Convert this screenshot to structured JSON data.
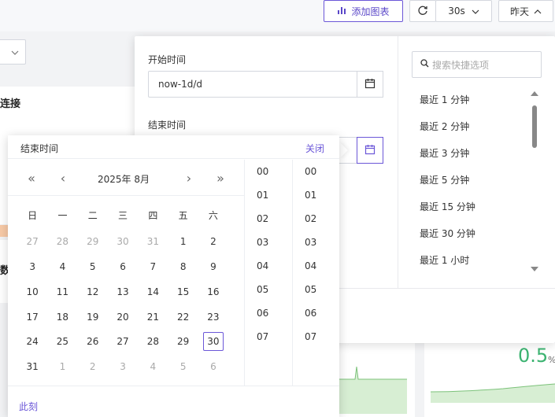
{
  "toolbar": {
    "add_chart_label": "添加图表",
    "refresh_interval": "30s",
    "time_range": "昨天"
  },
  "background": {
    "panel_title_1": "连接",
    "panel_title_2": "数",
    "metric_value": "0.5",
    "metric_unit": "%"
  },
  "range": {
    "start_label": "开始时间",
    "start_value": "now-1d/d",
    "end_label": "结束时间",
    "end_value": ""
  },
  "quick": {
    "search_placeholder": "搜索快捷选项",
    "items": [
      "最近 1 分钟",
      "最近 2 分钟",
      "最近 3 分钟",
      "最近 5 分钟",
      "最近 15 分钟",
      "最近 30 分钟",
      "最近 1 小时"
    ]
  },
  "datepicker": {
    "title": "结束时间",
    "close_label": "关闭",
    "nav": {
      "prev_year": "«",
      "prev_month": "‹",
      "next_month": "›",
      "next_year": "»"
    },
    "year": "2025年",
    "month": "8月",
    "weekdays": [
      "日",
      "一",
      "二",
      "三",
      "四",
      "五",
      "六"
    ],
    "weeks": [
      [
        "27",
        "28",
        "29",
        "30",
        "31",
        "1",
        "2"
      ],
      [
        "3",
        "4",
        "5",
        "6",
        "7",
        "8",
        "9"
      ],
      [
        "10",
        "11",
        "12",
        "13",
        "14",
        "15",
        "16"
      ],
      [
        "17",
        "18",
        "19",
        "20",
        "21",
        "22",
        "23"
      ],
      [
        "24",
        "25",
        "26",
        "27",
        "28",
        "29",
        "30"
      ],
      [
        "31",
        "1",
        "2",
        "3",
        "4",
        "5",
        "6"
      ]
    ],
    "selected_day": "30",
    "hours": [
      "00",
      "01",
      "02",
      "03",
      "04",
      "05",
      "06",
      "07"
    ],
    "minutes": [
      "00",
      "01",
      "02",
      "03",
      "04",
      "05",
      "06",
      "07"
    ],
    "now_label": "此刻"
  },
  "colors": {
    "accent": "#6b57d8",
    "metric_green": "#3cb371"
  }
}
